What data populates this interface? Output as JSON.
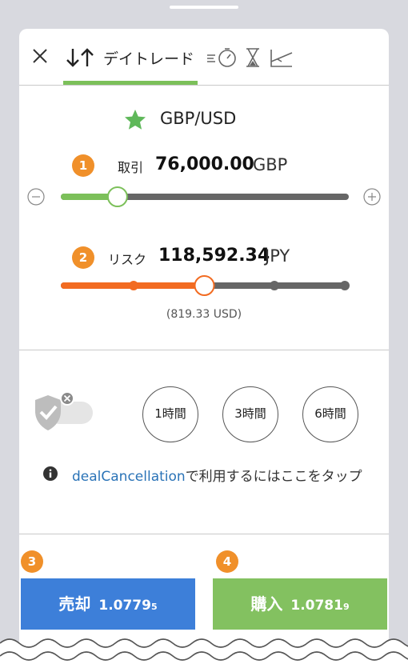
{
  "header": {
    "close_icon": "close-icon",
    "active_tab_label": "デイトレード",
    "other_tab_icons": [
      "ladder-stopwatch-icon",
      "hourglass-icon",
      "chart-limit-icon"
    ],
    "accent": "#7cc05a"
  },
  "instrument": {
    "favorite_icon": "star-icon",
    "name": "GBP/USD",
    "star_color": "#5fb85a"
  },
  "trade": {
    "badge": "1",
    "label": "取引",
    "value": "76,000.00",
    "unit": "GBP",
    "slider_fraction": 0.19,
    "minus_icon": "minus-circle-icon",
    "plus_icon": "plus-circle-icon"
  },
  "risk": {
    "badge": "2",
    "label": "リスク",
    "value": "118,592.34",
    "unit": "JPY",
    "slider_fraction": 0.5,
    "secondary": "(819.33 USD)",
    "accent": "#f26b21"
  },
  "cancellation": {
    "toggle_icon": "shield-check-icon",
    "toggle_on": false,
    "time_options": [
      "1時間",
      "3時間",
      "6時間"
    ],
    "info_icon": "info-icon",
    "info_link": "dealCancellation",
    "info_text": "で利用するにはここをタップ"
  },
  "actions": {
    "sell_badge": "3",
    "sell_label": "売却",
    "sell_price_main": "1.0779",
    "sell_price_small": "5",
    "buy_badge": "4",
    "buy_label": "購入",
    "buy_price_main": "1.0781",
    "buy_price_small": "9",
    "sell_color": "#3d7fd9",
    "buy_color": "#83c160"
  }
}
